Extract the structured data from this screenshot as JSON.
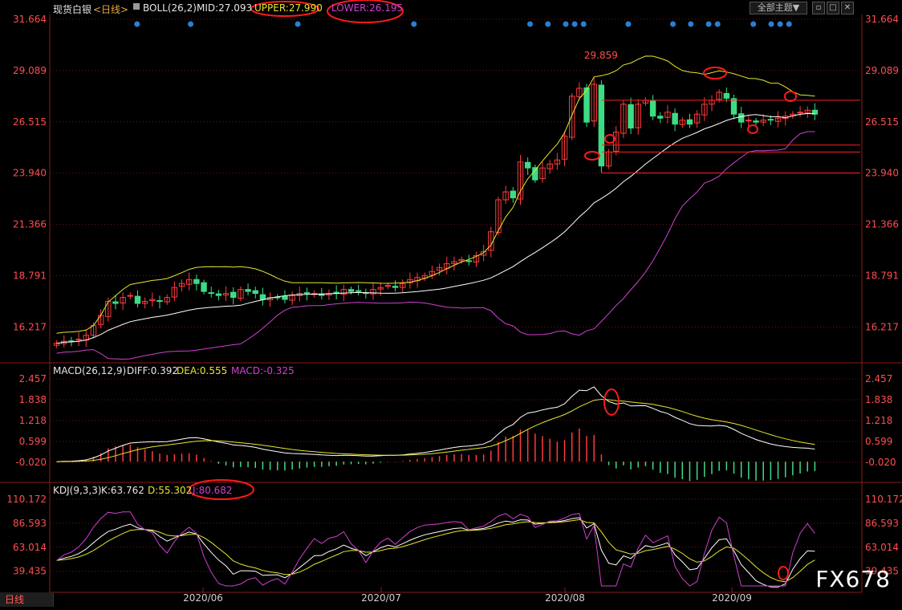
{
  "header": {
    "symbol": "现货白银",
    "period": "<日线>",
    "boll_name": "BOLL(26,2)",
    "mid": "MID:27.093",
    "upper": "UPPER:27.990",
    "lower": "LOWER:26.195",
    "theme_button": "全部主题▼"
  },
  "macd_header": {
    "name": "MACD(26,12,9)",
    "diff": "DIFF:0.392",
    "dea": "DEA:0.555",
    "macd": "MACD:-0.325"
  },
  "kdj_header": {
    "name": "KDJ(9,3,3)",
    "k": "K:63.762",
    "d": "D:55.302",
    "j": "J:80.682"
  },
  "tab_label": "日线",
  "watermark": "FX678",
  "colors": {
    "up": "#ff3b3b",
    "down": "#3ddc84",
    "mid": "#ffffff",
    "upper": "#e6e62e",
    "lower": "#d040d0",
    "grid": "#7a1010",
    "axis": "#ff4d4d"
  },
  "chart_data": [
    {
      "type": "candlestick",
      "title": "现货白银",
      "y_ticks": [
        "31.664",
        "29.089",
        "26.515",
        "23.940",
        "21.366",
        "18.791",
        "16.217"
      ],
      "ylim": [
        14.5,
        31.664
      ],
      "x_ticks": [
        "2020/06",
        "2020/07",
        "2020/08",
        "2020/09"
      ],
      "peak_label": "29.859",
      "close": [
        15.4,
        15.5,
        15.5,
        15.6,
        15.8,
        16.3,
        16.8,
        17.5,
        17.4,
        17.7,
        17.8,
        17.4,
        17.5,
        17.6,
        17.5,
        17.7,
        18.2,
        18.4,
        18.6,
        18.4,
        18.0,
        17.9,
        17.8,
        17.9,
        17.7,
        18.1,
        18.0,
        17.9,
        17.6,
        17.7,
        17.7,
        17.6,
        17.8,
        17.9,
        17.9,
        17.9,
        17.8,
        17.9,
        17.9,
        18.1,
        18.0,
        18.0,
        17.9,
        18.1,
        18.2,
        18.3,
        18.2,
        18.4,
        18.6,
        18.7,
        18.8,
        19.0,
        19.2,
        19.4,
        19.5,
        19.6,
        19.5,
        19.8,
        20.0,
        21.0,
        22.6,
        23.0,
        22.7,
        24.5,
        24.2,
        23.6,
        24.2,
        24.4,
        24.6,
        25.8,
        27.8,
        28.2,
        26.5,
        28.4,
        24.3,
        25.0,
        26.0,
        27.4,
        26.2,
        27.4,
        27.6,
        26.8,
        26.7,
        27.0,
        26.4,
        26.6,
        26.4,
        26.9,
        27.4,
        27.6,
        28.0,
        27.7,
        26.9,
        26.5,
        26.6,
        26.5,
        26.6,
        26.6,
        26.7,
        26.8,
        26.9,
        27.0,
        27.1,
        26.9
      ]
    },
    {
      "type": "line",
      "title": "MACD(26,12,9)",
      "y_ticks": [
        "2.457",
        "1.838",
        "1.218",
        "0.599",
        "-0.020"
      ],
      "series": [
        {
          "name": "DIFF",
          "values": [
            0.392
          ]
        },
        {
          "name": "DEA",
          "values": [
            0.555
          ]
        },
        {
          "name": "MACD",
          "values": [
            -0.325
          ]
        }
      ]
    },
    {
      "type": "line",
      "title": "KDJ(9,3,3)",
      "y_ticks": [
        "110.172",
        "86.593",
        "63.014",
        "39.435"
      ],
      "series": [
        {
          "name": "K",
          "values": [
            63.762
          ]
        },
        {
          "name": "D",
          "values": [
            55.302
          ]
        },
        {
          "name": "J",
          "values": [
            80.682
          ]
        }
      ]
    }
  ]
}
